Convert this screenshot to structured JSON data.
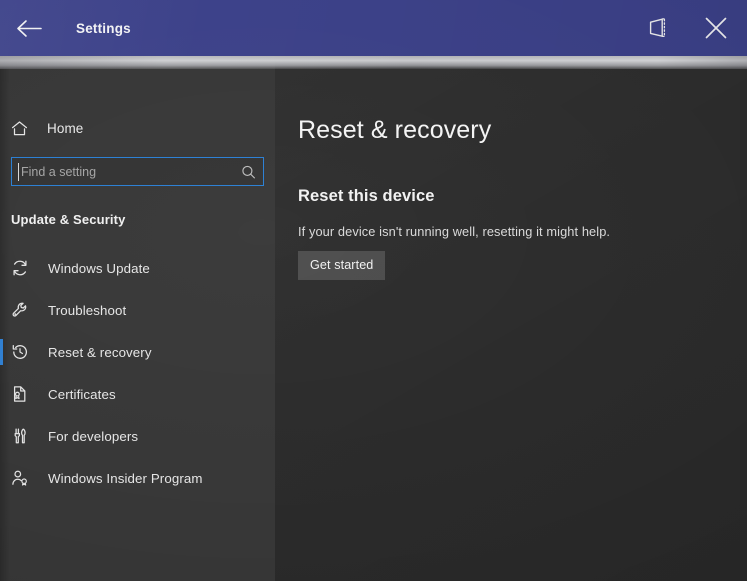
{
  "titlebar": {
    "back_label": "Back",
    "title": "Settings",
    "tablet_icon": "tablet-mode-icon",
    "close_label": "Close",
    "bg_color": "#3c4189"
  },
  "sidebar": {
    "home": {
      "label": "Home",
      "icon": "home-icon"
    },
    "search": {
      "placeholder": "Find a setting",
      "value": "",
      "icon": "search-icon",
      "focus_color": "#2a7fd4"
    },
    "group_heading": "Update & Security",
    "selected": "Reset & recovery",
    "accent_color": "#2f7fd1",
    "items": [
      {
        "label": "Windows Update",
        "icon": "sync-refresh-icon",
        "selected": false
      },
      {
        "label": "Troubleshoot",
        "icon": "wrench-icon",
        "selected": false
      },
      {
        "label": "Reset & recovery",
        "icon": "history-clock-icon",
        "selected": true
      },
      {
        "label": "Certificates",
        "icon": "certificate-document-icon",
        "selected": false
      },
      {
        "label": "For developers",
        "icon": "developer-tools-icon",
        "selected": false
      },
      {
        "label": "Windows Insider Program",
        "icon": "person-badge-icon",
        "selected": false
      }
    ]
  },
  "main": {
    "page_title": "Reset & recovery",
    "sections": [
      {
        "heading": "Reset this device",
        "description": "If your device isn't running well, resetting it might help.",
        "button": "Get started"
      }
    ]
  }
}
